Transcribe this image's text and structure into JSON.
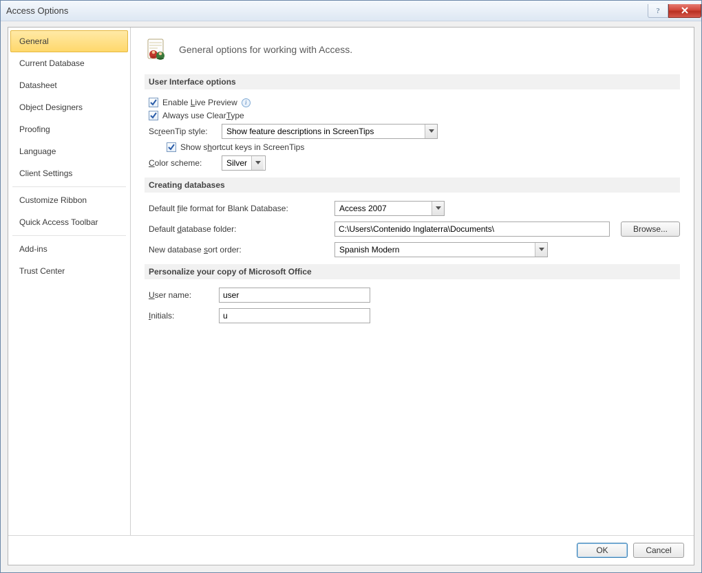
{
  "window": {
    "title": "Access Options"
  },
  "sidebar": {
    "groups": [
      [
        "General",
        "Current Database",
        "Datasheet",
        "Object Designers",
        "Proofing",
        "Language",
        "Client Settings"
      ],
      [
        "Customize Ribbon",
        "Quick Access Toolbar"
      ],
      [
        "Add-ins",
        "Trust Center"
      ]
    ],
    "selected": "General"
  },
  "header": {
    "headline": "General options for working with Access."
  },
  "sections": {
    "ui": {
      "title": "User Interface options",
      "enable_live_preview": "Enable Live Preview",
      "always_cleartype": "Always use ClearType",
      "screentip_style_label": "ScreenTip style:",
      "screentip_style_value": "Show feature descriptions in ScreenTips",
      "show_shortcut_keys": "Show shortcut keys in ScreenTips",
      "color_scheme_label": "Color scheme:",
      "color_scheme_value": "Silver"
    },
    "db": {
      "title": "Creating databases",
      "default_format_label": "Default file format for Blank Database:",
      "default_format_value": "Access 2007",
      "default_folder_label": "Default database folder:",
      "default_folder_value": "C:\\Users\\Contenido Inglaterra\\Documents\\",
      "browse_label": "Browse...",
      "sort_order_label": "New database sort order:",
      "sort_order_value": "Spanish Modern"
    },
    "personalize": {
      "title": "Personalize your copy of Microsoft Office",
      "username_label": "User name:",
      "username_value": "user",
      "initials_label": "Initials:",
      "initials_value": "u"
    }
  },
  "footer": {
    "ok": "OK",
    "cancel": "Cancel"
  }
}
